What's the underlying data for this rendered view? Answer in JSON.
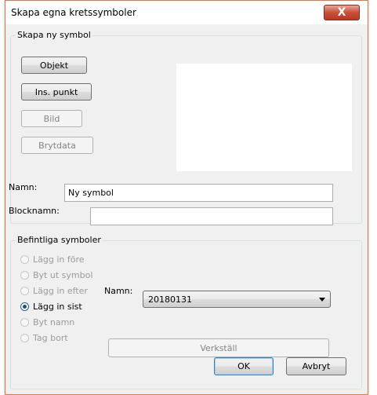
{
  "window": {
    "title": "Skapa egna kretssymboler",
    "close_glyph": "X"
  },
  "create_group": {
    "legend": "Skapa ny symbol",
    "buttons": {
      "objekt": "Objekt",
      "ins_punkt": "Ins. punkt",
      "bild": "Bild",
      "brytdata": "Brytdata"
    },
    "name_label": "Namn:",
    "name_value": "Ny symbol",
    "blockname_label": "Blocknamn:",
    "blockname_value": ""
  },
  "existing_group": {
    "legend": "Befintliga symboler",
    "radios": [
      {
        "label": "Lägg in före",
        "checked": false,
        "enabled": false
      },
      {
        "label": "Byt ut symbol",
        "checked": false,
        "enabled": false
      },
      {
        "label": "Lägg in efter",
        "checked": false,
        "enabled": false
      },
      {
        "label": "Lägg in sist",
        "checked": true,
        "enabled": true
      },
      {
        "label": "Byt namn",
        "checked": false,
        "enabled": false
      },
      {
        "label": "Tag bort",
        "checked": false,
        "enabled": false
      }
    ],
    "name_label": "Namn:",
    "name_selected": "20180131",
    "apply_label": "Verkställ"
  },
  "footer": {
    "ok_label": "OK",
    "cancel_label": "Avbryt"
  }
}
